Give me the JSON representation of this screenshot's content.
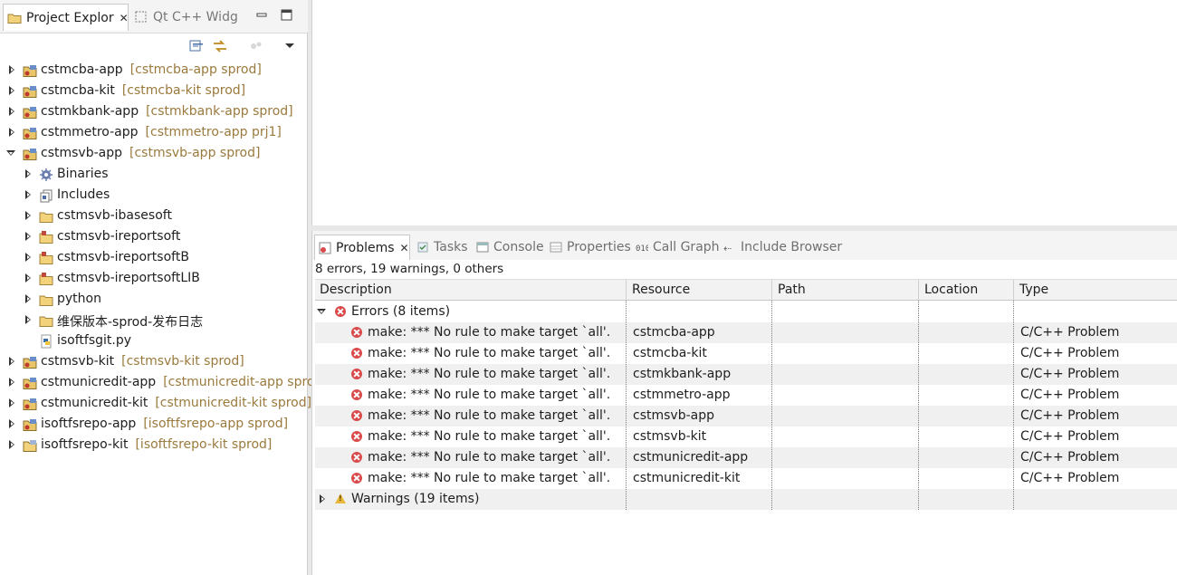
{
  "left_panel": {
    "tabs": [
      {
        "label": "Project Explor",
        "active": true,
        "icon": "folder-icon"
      },
      {
        "label": "Qt C++ Widg",
        "active": false,
        "icon": "qt-widget-icon"
      }
    ],
    "tree": [
      {
        "name": "cstmcba-app",
        "scm": "[cstmcba-app sprod]",
        "expanded": false,
        "indent": 0,
        "icon": "project-icon"
      },
      {
        "name": "cstmcba-kit",
        "scm": "[cstmcba-kit sprod]",
        "expanded": false,
        "indent": 0,
        "icon": "project-icon"
      },
      {
        "name": "cstmkbank-app",
        "scm": "[cstmkbank-app sprod]",
        "expanded": false,
        "indent": 0,
        "icon": "project-icon"
      },
      {
        "name": "cstmmetro-app",
        "scm": "[cstmmetro-app prj1]",
        "expanded": false,
        "indent": 0,
        "icon": "project-icon"
      },
      {
        "name": "cstmsvb-app",
        "scm": "[cstmsvb-app sprod]",
        "expanded": true,
        "indent": 0,
        "icon": "project-icon"
      },
      {
        "name": "Binaries",
        "scm": "",
        "expanded": false,
        "indent": 1,
        "icon": "binaries-icon"
      },
      {
        "name": "Includes",
        "scm": "",
        "expanded": false,
        "indent": 1,
        "icon": "includes-icon"
      },
      {
        "name": "cstmsvb-ibasesoft",
        "scm": "",
        "expanded": false,
        "indent": 1,
        "icon": "folder-icon"
      },
      {
        "name": "cstmsvb-ireportsoft",
        "scm": "",
        "expanded": false,
        "indent": 1,
        "icon": "source-folder-icon"
      },
      {
        "name": "cstmsvb-ireportsoftB",
        "scm": "",
        "expanded": false,
        "indent": 1,
        "icon": "source-folder-icon"
      },
      {
        "name": "cstmsvb-ireportsoftLIB",
        "scm": "",
        "expanded": false,
        "indent": 1,
        "icon": "source-folder-icon"
      },
      {
        "name": "python",
        "scm": "",
        "expanded": false,
        "indent": 1,
        "icon": "folder-icon"
      },
      {
        "name": "维保版本-sprod-发布日志",
        "scm": "",
        "expanded": false,
        "indent": 1,
        "icon": "folder-icon"
      },
      {
        "name": "isoftfsgit.py",
        "scm": "",
        "expanded": null,
        "indent": 1,
        "icon": "python-file-icon"
      },
      {
        "name": "cstmsvb-kit",
        "scm": "[cstmsvb-kit sprod]",
        "expanded": false,
        "indent": 0,
        "icon": "project-icon"
      },
      {
        "name": "cstmunicredit-app",
        "scm": "[cstmunicredit-app sprod]",
        "expanded": false,
        "indent": 0,
        "icon": "project-icon"
      },
      {
        "name": "cstmunicredit-kit",
        "scm": "[cstmunicredit-kit sprod]",
        "expanded": false,
        "indent": 0,
        "icon": "project-icon"
      },
      {
        "name": "isoftfsrepo-app",
        "scm": "[isoftfsrepo-app sprod]",
        "expanded": false,
        "indent": 0,
        "icon": "project-icon"
      },
      {
        "name": "isoftfsrepo-kit",
        "scm": "[isoftfsrepo-kit sprod]",
        "expanded": false,
        "indent": 0,
        "icon": "project-open-icon"
      }
    ]
  },
  "bottom_panel": {
    "tabs": [
      {
        "label": "Problems",
        "active": true,
        "icon": "problems-icon"
      },
      {
        "label": "Tasks",
        "active": false,
        "icon": "tasks-icon"
      },
      {
        "label": "Console",
        "active": false,
        "icon": "console-icon"
      },
      {
        "label": "Properties",
        "active": false,
        "icon": "properties-icon"
      },
      {
        "label": "Call Graph",
        "active": false,
        "icon": "call-graph-icon"
      },
      {
        "label": "Include Browser",
        "active": false,
        "icon": "include-browser-icon"
      }
    ],
    "summary": "8 errors, 19 warnings, 0 others",
    "columns": [
      "Description",
      "Resource",
      "Path",
      "Location",
      "Type"
    ],
    "errors_group": "Errors (8 items)",
    "errors": [
      {
        "description": "make: *** No rule to make target `all'.",
        "resource": "cstmcba-app",
        "path": "",
        "location": "",
        "type": "C/C++ Problem"
      },
      {
        "description": "make: *** No rule to make target `all'.",
        "resource": "cstmcba-kit",
        "path": "",
        "location": "",
        "type": "C/C++ Problem"
      },
      {
        "description": "make: *** No rule to make target `all'.",
        "resource": "cstmkbank-app",
        "path": "",
        "location": "",
        "type": "C/C++ Problem"
      },
      {
        "description": "make: *** No rule to make target `all'.",
        "resource": "cstmmetro-app",
        "path": "",
        "location": "",
        "type": "C/C++ Problem"
      },
      {
        "description": "make: *** No rule to make target `all'.",
        "resource": "cstmsvb-app",
        "path": "",
        "location": "",
        "type": "C/C++ Problem"
      },
      {
        "description": "make: *** No rule to make target `all'.",
        "resource": "cstmsvb-kit",
        "path": "",
        "location": "",
        "type": "C/C++ Problem"
      },
      {
        "description": "make: *** No rule to make target `all'.",
        "resource": "cstmunicredit-app",
        "path": "",
        "location": "",
        "type": "C/C++ Problem"
      },
      {
        "description": "make: *** No rule to make target `all'.",
        "resource": "cstmunicredit-kit",
        "path": "",
        "location": "",
        "type": "C/C++ Problem"
      }
    ],
    "warnings_group": "Warnings (19 items)"
  },
  "colors": {
    "scm_annotation": "#9a7a3c",
    "error": "#d94b4b",
    "warning": "#e8b83a",
    "alt_row": "#f0f0f0"
  }
}
